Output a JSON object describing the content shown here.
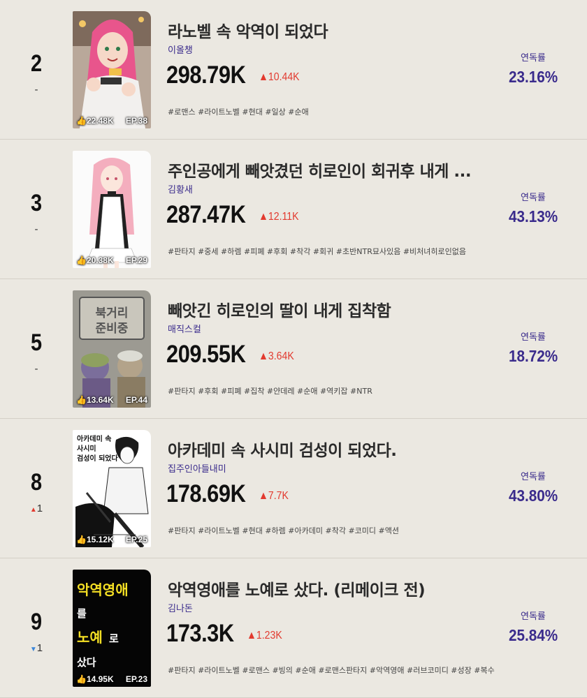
{
  "rows": [
    {
      "rank": "2",
      "change": "-",
      "change_dir": "none",
      "title": "라노벨 속 악역이 되었다",
      "author": "이올챙",
      "views": "298.79K",
      "delta": "▲10.44K",
      "tags": "#로맨스 #라이트노벨 #현대 #일상 #순애",
      "rate_label": "연독률",
      "rate": "23.16%",
      "likes": "22.48K",
      "ep": "EP.38"
    },
    {
      "rank": "3",
      "change": "-",
      "change_dir": "none",
      "title": "주인공에게 빼앗겼던 히로인이 회귀후 내게 ...",
      "author": "김황새",
      "views": "287.47K",
      "delta": "▲12.11K",
      "tags": "#판타지 #중세 #하렘 #피폐 #후회 #착각 #회귀 #초반NTR묘사있음 #비처녀히로인없음",
      "rate_label": "연독률",
      "rate": "43.13%",
      "likes": "20.38K",
      "ep": "EP.29"
    },
    {
      "rank": "5",
      "change": "-",
      "change_dir": "none",
      "title": "빼앗긴 히로인의 딸이 내게 집착함",
      "author": "매직스컬",
      "views": "209.55K",
      "delta": "▲3.64K",
      "tags": "#판타지 #후회 #피폐 #집착 #얀데레 #순애 #역키잡 #NTR",
      "rate_label": "연독률",
      "rate": "18.72%",
      "likes": "13.64K",
      "ep": "EP.44",
      "cover_text": [
        "북거리",
        "준비중"
      ]
    },
    {
      "rank": "8",
      "change": "1",
      "change_dir": "up",
      "title": "아카데미 속 사시미 검성이 되었다.",
      "author": "집주인아들내미",
      "views": "178.69K",
      "delta": "▲7.7K",
      "tags": "#판타지 #라이트노벨 #현대 #하렘 #아카데미 #착각 #코미디 #액션",
      "rate_label": "연독률",
      "rate": "43.80%",
      "likes": "15.12K",
      "ep": "EP.25",
      "cover_text": [
        "아카데미 속",
        "사시미",
        "검성이 되었다"
      ]
    },
    {
      "rank": "9",
      "change": "1",
      "change_dir": "down",
      "title": "악역영애를 노예로 샀다. (리메이크 전)",
      "author": "김나돈",
      "views": "173.3K",
      "delta": "▲1.23K",
      "tags": "#판타지 #라이트노벨 #로맨스 #빙의 #순애 #로맨스판타지 #악역영애 #러브코미디 #성장 #복수",
      "rate_label": "연독률",
      "rate": "25.84%",
      "likes": "14.95K",
      "ep": "EP.23",
      "cover_text": [
        "악역영애",
        "를",
        "노예",
        "로",
        "샀다"
      ]
    }
  ],
  "colors": {
    "background": "#ebe8e1",
    "accent_purple": "#3a2b8c",
    "delta_red": "#e23a2f",
    "down_blue": "#3a86d9"
  }
}
